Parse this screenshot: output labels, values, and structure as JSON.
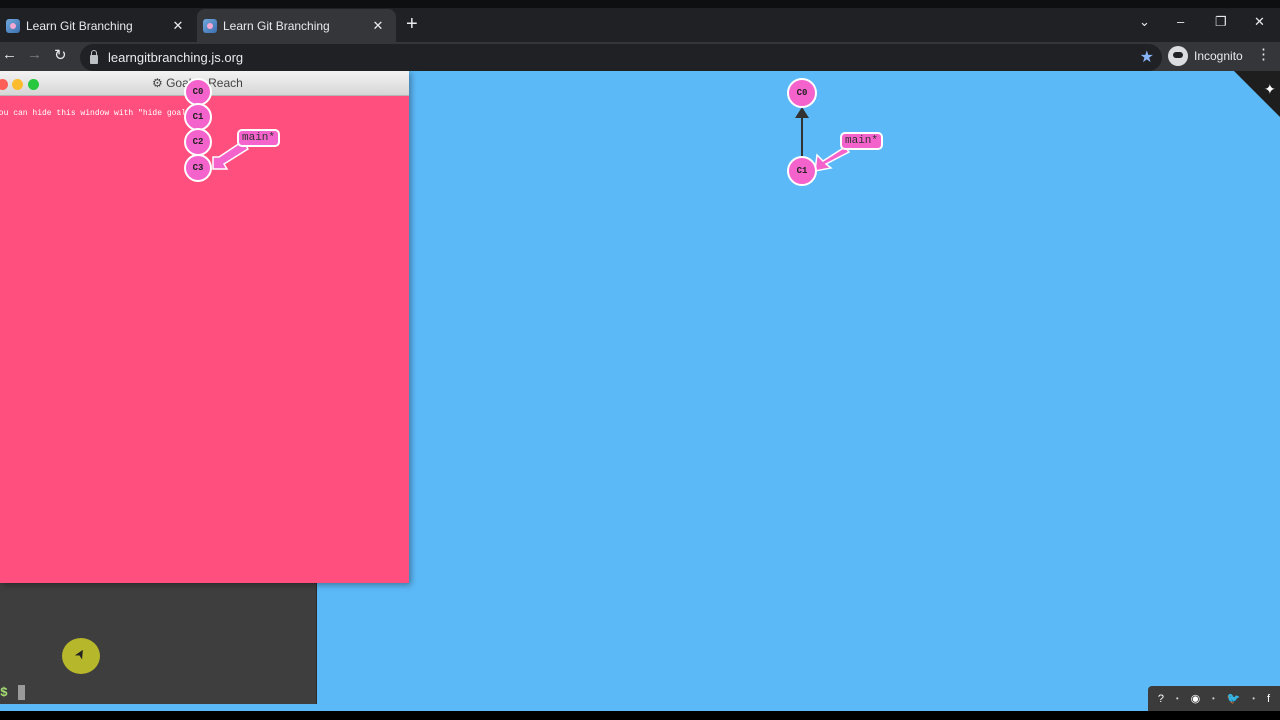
{
  "browser": {
    "tabs": [
      {
        "title": "Learn Git Branching",
        "close": "✕"
      },
      {
        "title": "Learn Git Branching",
        "close": "✕"
      }
    ],
    "new_tab": "+",
    "window_controls": {
      "chevron": "⌄",
      "minimize": "–",
      "restore": "❐",
      "close": "✕"
    },
    "nav": {
      "back": "←",
      "forward": "→",
      "reload": "↻"
    },
    "url": "learngitbranching.js.org",
    "profile_label": "Incognito",
    "menu": "⋮",
    "bookmark_star": "★"
  },
  "terminal": {
    "prompt": "$"
  },
  "goal_window": {
    "title": "⚙ Goal to Reach",
    "hint": "You can hide this window with \"hide goal\"",
    "commits": [
      "C0",
      "C1",
      "C2",
      "C3"
    ],
    "branch": "main*"
  },
  "main_tree": {
    "commits": [
      "C0",
      "C1"
    ],
    "branch": "main*"
  },
  "help_bar": {
    "items": [
      "?",
      "◉",
      "🐦",
      "f"
    ],
    "separator": "•"
  },
  "colors": {
    "canvas_bg": "#5cb9f7",
    "goal_bg": "#ff4f7e",
    "commit_fill": "#f462cc",
    "terminal_bg": "#3e3e3e"
  }
}
